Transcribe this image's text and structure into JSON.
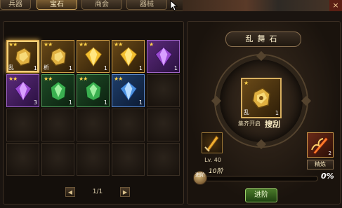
{
  "tabs": [
    {
      "label": "兵器"
    },
    {
      "label": "宝石"
    },
    {
      "label": "商会"
    },
    {
      "label": "器械"
    }
  ],
  "close_label": "×",
  "grid": {
    "slots": [
      {
        "filled": true,
        "kind": "gold",
        "stars": "★★",
        "glyph": "乱",
        "count": "1",
        "selected": true,
        "gem": "gold-rock"
      },
      {
        "filled": true,
        "kind": "gold",
        "stars": "★★",
        "glyph": "析",
        "count": "1",
        "gem": "gold-rock"
      },
      {
        "filled": true,
        "kind": "gold",
        "stars": "★★",
        "glyph": "",
        "count": "1",
        "gem": "yellow-diamond"
      },
      {
        "filled": true,
        "kind": "gold",
        "stars": "★★",
        "glyph": "",
        "count": "1",
        "gem": "yellow-diamond"
      },
      {
        "filled": true,
        "kind": "purple",
        "stars": "★",
        "glyph": "",
        "count": "1",
        "gem": "purple-diamond"
      },
      {
        "filled": true,
        "kind": "purple",
        "stars": "★★",
        "glyph": "",
        "count": "3",
        "gem": "purple-diamond"
      },
      {
        "filled": true,
        "kind": "green",
        "stars": "★★",
        "glyph": "",
        "count": "1",
        "gem": "green-emerald"
      },
      {
        "filled": true,
        "kind": "green",
        "stars": "★★",
        "glyph": "",
        "count": "1",
        "gem": "green-emerald"
      },
      {
        "filled": true,
        "kind": "blue",
        "stars": "★★",
        "glyph": "",
        "count": "1",
        "gem": "blue-diamond"
      }
    ],
    "total_slots": 20,
    "columns": 5
  },
  "pager": {
    "prev": "◀",
    "text": "1/1",
    "next": "▶"
  },
  "detail": {
    "title": "乱舞石",
    "center_stars": "★",
    "center_glyph": "乱",
    "center_count": "1",
    "status": "集齐开启",
    "search": "搜刮",
    "level": "Lv. 40",
    "refine_count": "2",
    "refine_label": "精炼",
    "orb_text": "进阶",
    "progress_level": "10阶",
    "progress_percent": "0%",
    "progress_value": 0,
    "upgrade_button": "进阶"
  },
  "colors": {
    "accent_gold": "#d9b060",
    "stars": "#ffd34a"
  }
}
